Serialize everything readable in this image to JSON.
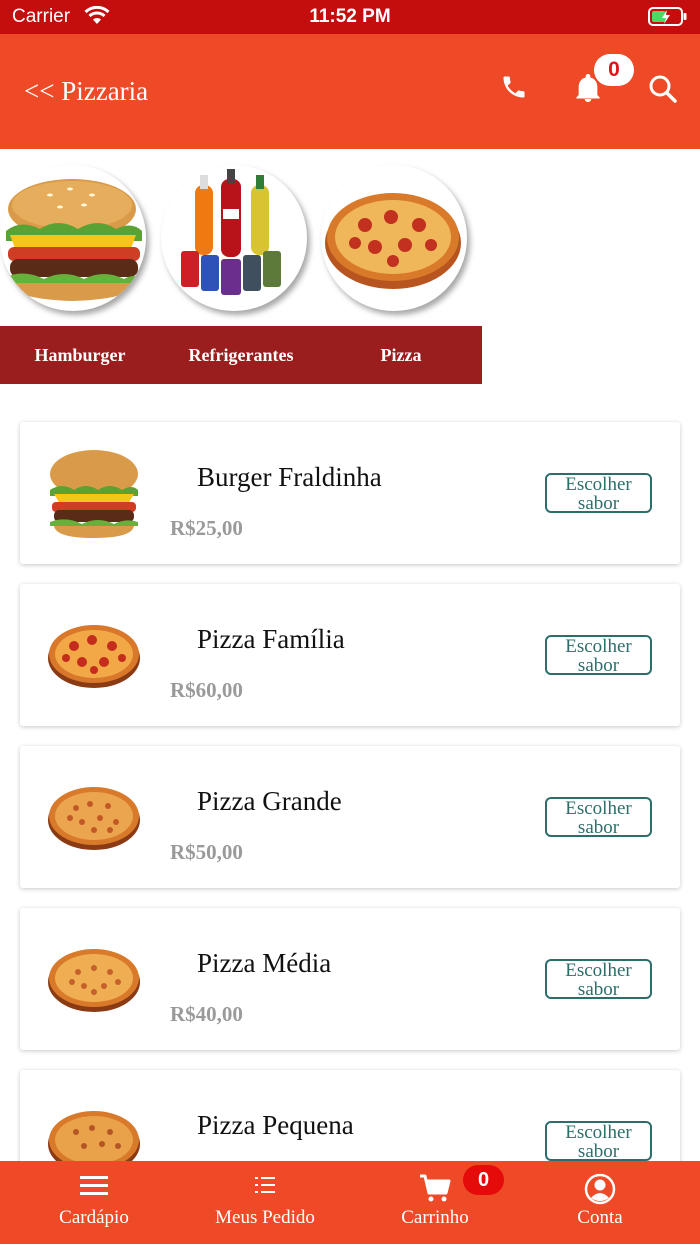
{
  "status_bar": {
    "carrier": "Carrier",
    "time": "11:52 PM"
  },
  "header": {
    "title": "<< Pizzaria",
    "notification_count": "0"
  },
  "categories": [
    {
      "label": "Hamburger",
      "icon": "hamburger-image"
    },
    {
      "label": "Refrigerantes",
      "icon": "soft-drinks-image"
    },
    {
      "label": "Pizza",
      "icon": "pizza-image"
    }
  ],
  "products": [
    {
      "name": "Burger Fraldinha",
      "price": "R$25,00",
      "button": "Escolher sabor",
      "image": "burger-image"
    },
    {
      "name": "Pizza Família",
      "price": "R$60,00",
      "button": "Escolher sabor",
      "image": "pizza-image"
    },
    {
      "name": "Pizza Grande",
      "price": "R$50,00",
      "button": "Escolher sabor",
      "image": "pizza-image"
    },
    {
      "name": "Pizza Média",
      "price": "R$40,00",
      "button": "Escolher sabor",
      "image": "pizza-image"
    },
    {
      "name": "Pizza Pequena",
      "price": "",
      "button": "Escolher sabor",
      "image": "pizza-image"
    }
  ],
  "bottom_nav": {
    "menu": "Cardápio",
    "orders": "Meus Pedido",
    "cart": "Carrinho",
    "account": "Conta",
    "cart_count": "0"
  },
  "colors": {
    "header": "#ef4a27",
    "status_bar": "#c40d0d",
    "category_bar": "#9a1e1e",
    "button_border": "#2c6e6a",
    "price": "#9a9a9a"
  }
}
